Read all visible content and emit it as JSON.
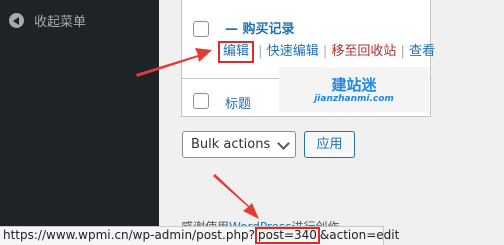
{
  "sidebar": {
    "collapse_label": "收起菜单"
  },
  "table": {
    "row_title": "— 购买记录",
    "actions": [
      "编辑",
      "快速编辑",
      "移至回收站",
      "查看"
    ],
    "separator": "|",
    "column_title": "标题"
  },
  "watermark": {
    "title": "建站迷",
    "subtitle": "jianzhanmi.com"
  },
  "bulk": {
    "selected": "Bulk actions",
    "apply_label": "应用"
  },
  "footer": {
    "prefix": "感谢使用",
    "link": "WordPress",
    "suffix": "进行创作。"
  },
  "statusbar": {
    "url_prefix": "https://www.wpmi.cn/wp-admin/post.php?",
    "url_highlight": "post=340",
    "url_suffix": "&action=edit"
  },
  "colors": {
    "highlight": "#e02a2a",
    "link": "#2271b1",
    "sidebar": "#1d2327"
  }
}
